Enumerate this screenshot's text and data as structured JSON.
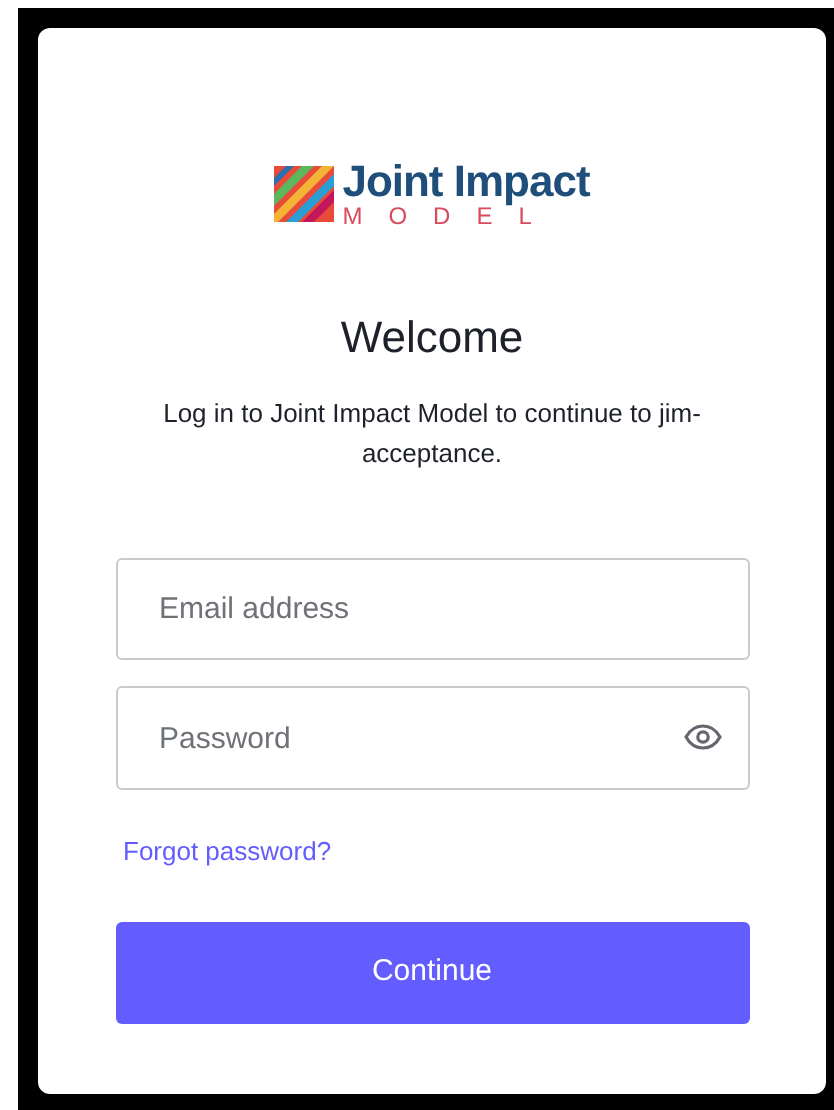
{
  "logo": {
    "name": "Joint Impact",
    "tagline": "MODEL"
  },
  "title": "Welcome",
  "description": "Log in to Joint Impact Model to continue to jim-acceptance.",
  "email_field": {
    "placeholder": "Email address"
  },
  "password_field": {
    "placeholder": "Password"
  },
  "forgot_link": "Forgot password?",
  "continue_button": "Continue"
}
